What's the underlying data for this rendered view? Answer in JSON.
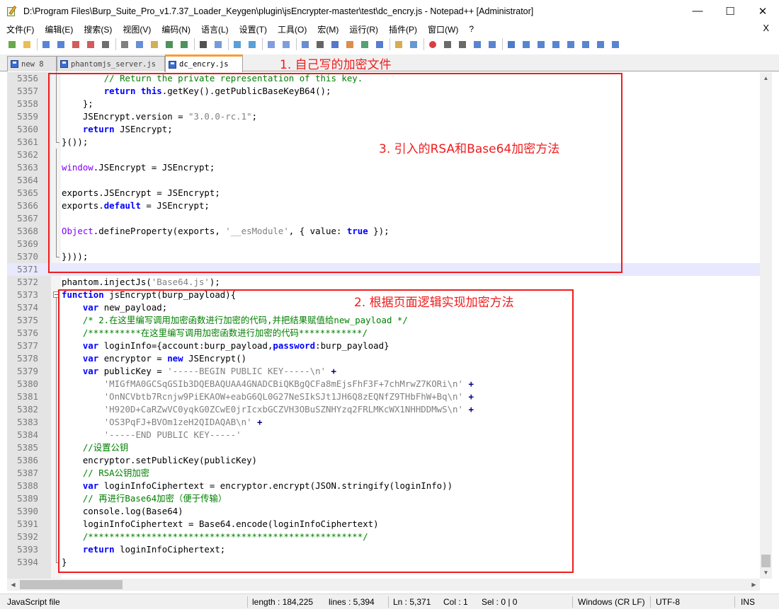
{
  "window": {
    "title": "D:\\Program Files\\Burp_Suite_Pro_v1.7.37_Loader_Keygen\\plugin\\jsEncrypter-master\\test\\dc_encry.js - Notepad++ [Administrator]",
    "minimize": "—",
    "maximize": "☐",
    "close": "✕"
  },
  "menu": {
    "items": [
      "文件(F)",
      "编辑(E)",
      "搜索(S)",
      "视图(V)",
      "编码(N)",
      "语言(L)",
      "设置(T)",
      "工具(O)",
      "宏(M)",
      "运行(R)",
      "插件(P)",
      "窗口(W)",
      "?"
    ],
    "close_doc": "X"
  },
  "toolbar": {
    "icons": [
      "new-file-icon",
      "open-file-icon",
      "save-icon",
      "save-all-icon",
      "close-icon",
      "close-all-icon",
      "print-icon",
      "cut-icon",
      "copy-icon",
      "paste-icon",
      "undo-icon",
      "redo-icon",
      "find-icon",
      "replace-icon",
      "zoom-in-icon",
      "zoom-out-icon",
      "sync-vertical-icon",
      "sync-horizontal-icon",
      "word-wrap-icon",
      "show-all-chars-icon",
      "indent-guide-icon",
      "udl-icon",
      "doc-map-icon",
      "function-list-icon",
      "folder-workspace-icon",
      "monitoring-icon",
      "record-macro-icon",
      "stop-macro-icon",
      "play-macro-icon",
      "run-macro-multiple-icon",
      "save-macro-icon",
      "plugin-1-icon",
      "plugin-2-icon",
      "plugin-3-icon",
      "plugin-4-icon",
      "plugin-5-icon",
      "plugin-6-icon",
      "plugin-7-icon",
      "plugin-8-icon"
    ]
  },
  "tabs": [
    {
      "label": "new 8",
      "active": false
    },
    {
      "label": "phantomjs_server.js",
      "active": false
    },
    {
      "label": "dc_encry.js",
      "active": true
    }
  ],
  "editor": {
    "current_line": 5371,
    "lines": [
      {
        "n": "5356",
        "fold": "vl",
        "html": "        <span class=\"cm\">// Return the private representation of this key.</span>"
      },
      {
        "n": "5357",
        "fold": "vl",
        "html": "        <span class=\"kw\">return</span> <span class=\"kw\">this</span>.getKey().getPublicBaseKeyB64();"
      },
      {
        "n": "5358",
        "fold": "vl",
        "html": "    };"
      },
      {
        "n": "5359",
        "fold": "vl",
        "html": "    JSEncrypt.version = <span class=\"str\">\"3.0.0-rc.1\"</span>;"
      },
      {
        "n": "5360",
        "fold": "vl",
        "html": "    <span class=\"kw\">return</span> JSEncrypt;"
      },
      {
        "n": "5361",
        "fold": "corner",
        "html": "}());"
      },
      {
        "n": "5362",
        "fold": "vl",
        "html": ""
      },
      {
        "n": "5363",
        "fold": "vl",
        "html": "<span class=\"obj\">window</span>.JSEncrypt = JSEncrypt;"
      },
      {
        "n": "5364",
        "fold": "vl",
        "html": ""
      },
      {
        "n": "5365",
        "fold": "vl",
        "html": "exports.JSEncrypt = JSEncrypt;"
      },
      {
        "n": "5366",
        "fold": "vl",
        "html": "exports.<span class=\"kw\">default</span> = JSEncrypt;"
      },
      {
        "n": "5367",
        "fold": "vl",
        "html": ""
      },
      {
        "n": "5368",
        "fold": "vl",
        "html": "<span class=\"obj\">Object</span>.defineProperty(exports, <span class=\"str\">'__esModule'</span>, { value: <span class=\"kw\">true</span> });"
      },
      {
        "n": "5369",
        "fold": "vl",
        "html": ""
      },
      {
        "n": "5370",
        "fold": "corner",
        "html": "})));"
      },
      {
        "n": "5371",
        "fold": "",
        "html": ""
      },
      {
        "n": "5372",
        "fold": "",
        "html": "phantom.injectJs(<span class=\"str\">'Base64.js'</span>);"
      },
      {
        "n": "5373",
        "fold": "box",
        "html": "<span class=\"kw\">function</span> jsEncrypt(burp_payload){"
      },
      {
        "n": "5374",
        "fold": "vl",
        "html": "    <span class=\"kw\">var</span> new_payload;"
      },
      {
        "n": "5375",
        "fold": "vl",
        "html": "    <span class=\"cm\">/* 2.在这里编写调用加密函数进行加密的代码,并把结果赋值给new_payload */</span>"
      },
      {
        "n": "5376",
        "fold": "vl",
        "html": "    <span class=\"cm\">/**********在这里编写调用加密函数进行加密的代码************/</span>"
      },
      {
        "n": "5377",
        "fold": "vl",
        "html": "    <span class=\"kw\">var</span> loginInfo={account:burp_payload,<span class=\"kw\">password</span>:burp_payload}"
      },
      {
        "n": "5378",
        "fold": "vl",
        "html": "    <span class=\"kw\">var</span> encryptor = <span class=\"kw\">new</span> JSEncrypt()"
      },
      {
        "n": "5379",
        "fold": "vl",
        "html": "    <span class=\"kw\">var</span> publicKey = <span class=\"str\">'-----BEGIN PUBLIC KEY-----\\n'</span> <span class=\"op\">+</span>"
      },
      {
        "n": "5380",
        "fold": "vl",
        "html": "        <span class=\"str\">'MIGfMA0GCSqGSIb3DQEBAQUAA4GNADCBiQKBgQCFa8mEjsFhF3F+7chMrwZ7KORi\\n'</span> <span class=\"op\">+</span>"
      },
      {
        "n": "5381",
        "fold": "vl",
        "html": "        <span class=\"str\">'OnNCVbtb7Rcnjw9PiEKAOW+eabG6QL0G27NeSIkSJt1JH6Q8zEQNfZ9THbFhW+Bq\\n'</span> <span class=\"op\">+</span>"
      },
      {
        "n": "5382",
        "fold": "vl",
        "html": "        <span class=\"str\">'H920D+CaRZwVC0yqkG0ZCwE0jrIcxbGCZVH3OBuSZNHYzq2FRLMKcWX1NHHDDMwS\\n'</span> <span class=\"op\">+</span>"
      },
      {
        "n": "5383",
        "fold": "vl",
        "html": "        <span class=\"str\">'OS3PqFJ+BVOm1zeH2QIDAQAB\\n'</span> <span class=\"op\">+</span>"
      },
      {
        "n": "5384",
        "fold": "vl",
        "html": "        <span class=\"str\">'-----END PUBLIC KEY-----'</span>"
      },
      {
        "n": "5385",
        "fold": "vl",
        "html": "    <span class=\"cm\">//设置公钥</span>"
      },
      {
        "n": "5386",
        "fold": "vl",
        "html": "    encryptor.setPublicKey(publicKey)"
      },
      {
        "n": "5387",
        "fold": "vl",
        "html": "    <span class=\"cm\">// RSA公钥加密</span>"
      },
      {
        "n": "5388",
        "fold": "vl",
        "html": "    <span class=\"kw\">var</span> loginInfoCiphertext = encryptor.encrypt(JSON.stringify(loginInfo))"
      },
      {
        "n": "5389",
        "fold": "vl",
        "html": "    <span class=\"cm\">// 再进行Base64加密（便于传输）</span>"
      },
      {
        "n": "5390",
        "fold": "vl",
        "html": "    console.log(Base64)"
      },
      {
        "n": "5391",
        "fold": "vl",
        "html": "    loginInfoCiphertext = Base64.encode(loginInfoCiphertext)"
      },
      {
        "n": "5392",
        "fold": "vl",
        "html": "    <span class=\"cm\">/****************************************************/</span>"
      },
      {
        "n": "5393",
        "fold": "vl",
        "html": "    <span class=\"kw\">return</span> loginInfoCiphertext;"
      },
      {
        "n": "5394",
        "fold": "corner",
        "html": "}"
      }
    ]
  },
  "annotations": [
    {
      "label": "1. 自己写的加密文件"
    },
    {
      "label": "3. 引入的RSA和Base64加密方法"
    },
    {
      "label": "2. 根据页面逻辑实现加密方法"
    }
  ],
  "statusbar": {
    "language": "JavaScript file",
    "length": "length : 184,225",
    "lines": "lines : 5,394",
    "ln": "Ln : 5,371",
    "col": "Col : 1",
    "sel": "Sel : 0 | 0",
    "eol": "Windows (CR LF)",
    "encoding": "UTF-8",
    "mode": "INS"
  },
  "colors": {
    "annotation_red": "#f01c1c",
    "keyword_blue": "#0000ff",
    "comment_green": "#008000",
    "string_gray": "#808080",
    "active_tab_accent": "#fa9b35"
  }
}
